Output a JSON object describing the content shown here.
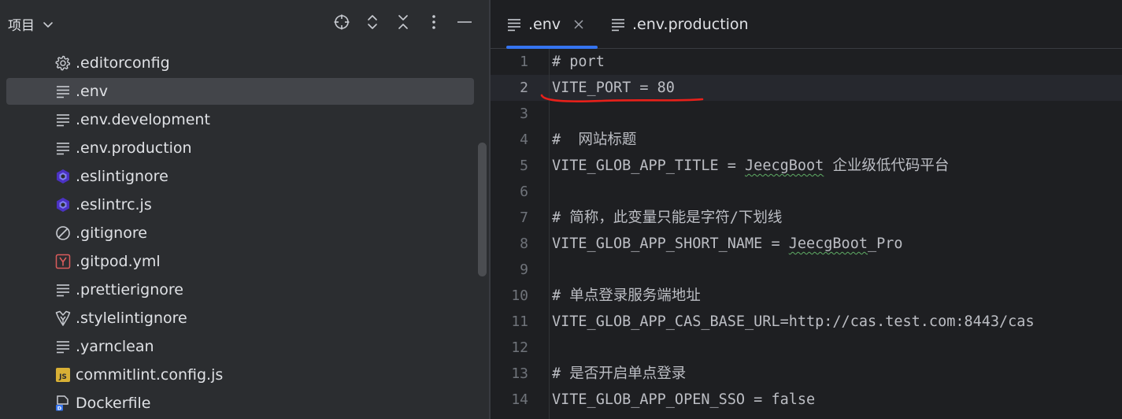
{
  "project": {
    "title": "项目",
    "tools": [
      "locate-icon",
      "expand-collapse-icon",
      "collapse-all-icon",
      "more-options-icon",
      "hide-icon"
    ],
    "files": [
      {
        "name": ".editorconfig",
        "icon": "gear-icon"
      },
      {
        "name": ".env",
        "icon": "text-file-icon",
        "selected": true
      },
      {
        "name": ".env.development",
        "icon": "text-file-icon"
      },
      {
        "name": ".env.production",
        "icon": "text-file-icon"
      },
      {
        "name": ".eslintignore",
        "icon": "eslint-icon"
      },
      {
        "name": ".eslintrc.js",
        "icon": "eslint-icon"
      },
      {
        "name": ".gitignore",
        "icon": "ignore-icon"
      },
      {
        "name": ".gitpod.yml",
        "icon": "yaml-icon"
      },
      {
        "name": ".prettierignore",
        "icon": "text-file-icon"
      },
      {
        "name": ".stylelintignore",
        "icon": "stylelint-icon"
      },
      {
        "name": ".yarnclean",
        "icon": "text-file-icon"
      },
      {
        "name": "commitlint.config.js",
        "icon": "js-icon"
      },
      {
        "name": "Dockerfile",
        "icon": "docker-icon"
      }
    ]
  },
  "editor": {
    "tabs": [
      {
        "label": ".env",
        "active": true
      },
      {
        "label": ".env.production",
        "active": false
      }
    ],
    "current_line": 2,
    "lines": [
      {
        "n": "1",
        "text": "# port"
      },
      {
        "n": "2",
        "text": "VITE_PORT = 80"
      },
      {
        "n": "3",
        "text": ""
      },
      {
        "n": "4",
        "text": "#  网站标题"
      },
      {
        "n": "5",
        "pre": "VITE_GLOB_APP_TITLE = ",
        "sq": "JeecgBoot",
        "post": " 企业级低代码平台"
      },
      {
        "n": "6",
        "text": ""
      },
      {
        "n": "7",
        "text": "# 简称，此变量只能是字符/下划线"
      },
      {
        "n": "8",
        "pre": "VITE_GLOB_APP_SHORT_NAME = ",
        "sq": "JeecgBoot",
        "post": "_Pro"
      },
      {
        "n": "9",
        "text": ""
      },
      {
        "n": "10",
        "text": "# 单点登录服务端地址"
      },
      {
        "n": "11",
        "text": "VITE_GLOB_APP_CAS_BASE_URL=http://cas.test.com:8443/cas"
      },
      {
        "n": "12",
        "text": ""
      },
      {
        "n": "13",
        "text": "# 是否开启单点登录"
      },
      {
        "n": "14",
        "text": "VITE_GLOB_APP_OPEN_SSO = false"
      }
    ]
  },
  "colors": {
    "panel_bg": "#2b2d30",
    "editor_bg": "#1e1f22",
    "accent": "#3574f0",
    "annotation": "#e8201a"
  }
}
